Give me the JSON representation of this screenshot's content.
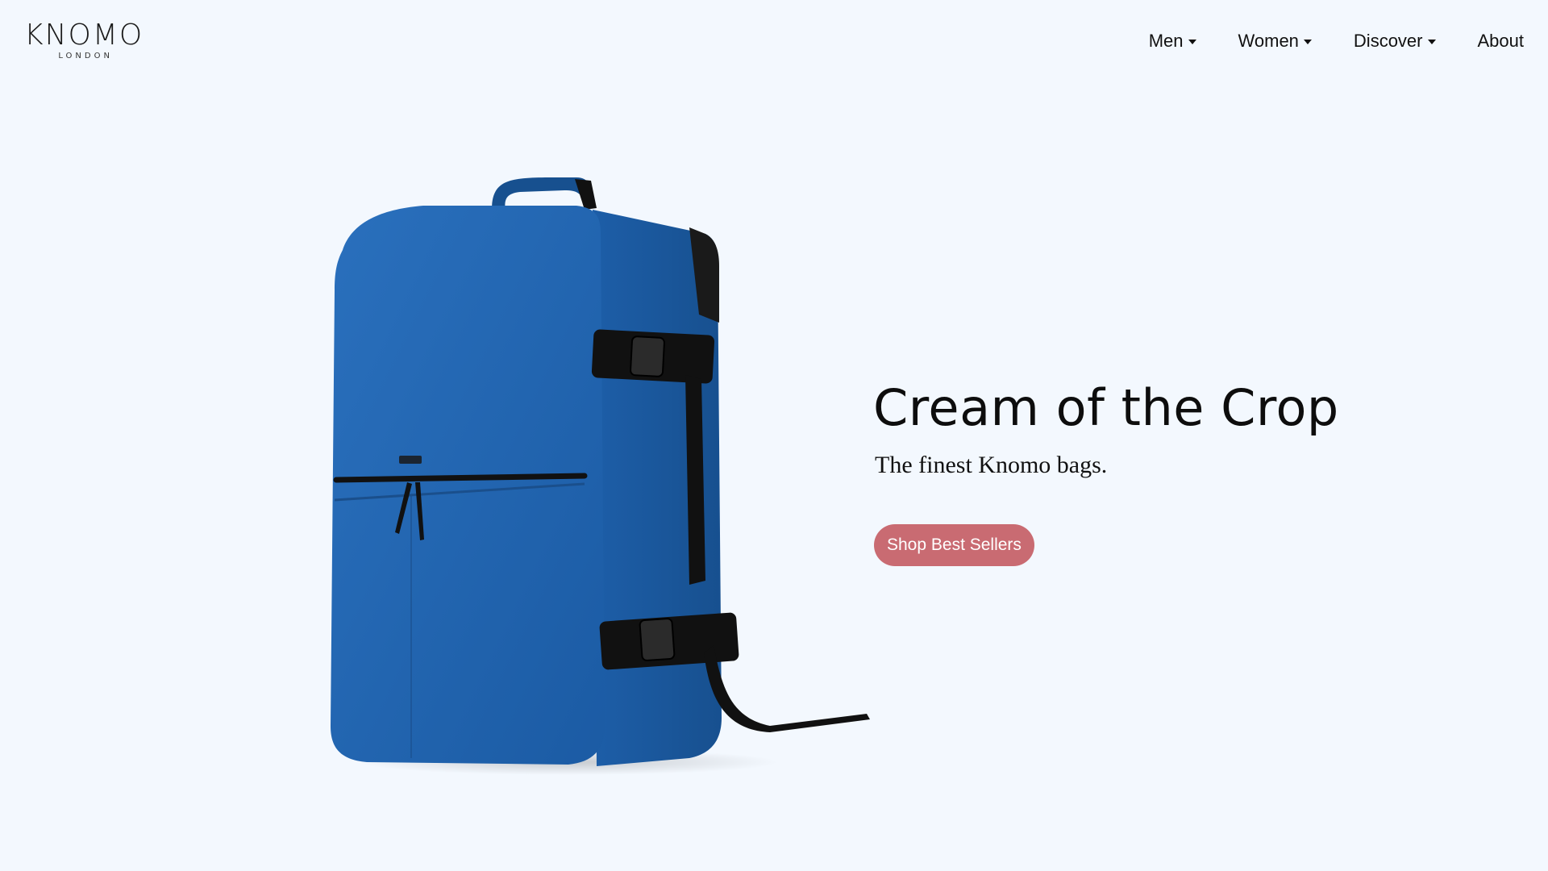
{
  "header": {
    "logo": {
      "word": "KNOMO",
      "sub": "LONDON"
    },
    "nav": [
      {
        "label": "Men",
        "has_dropdown": true
      },
      {
        "label": "Women",
        "has_dropdown": true
      },
      {
        "label": "Discover",
        "has_dropdown": true
      },
      {
        "label": "About",
        "has_dropdown": false
      }
    ]
  },
  "hero": {
    "title": "Cream of the Crop",
    "subtitle": "The finest Knomo bags.",
    "cta_label": "Shop Best Sellers",
    "image_icon": "blue-backpack-product-image",
    "colors": {
      "background": "#f3f8fe",
      "cta": "#c96b72",
      "bag_blue": "#1f62ae"
    }
  }
}
